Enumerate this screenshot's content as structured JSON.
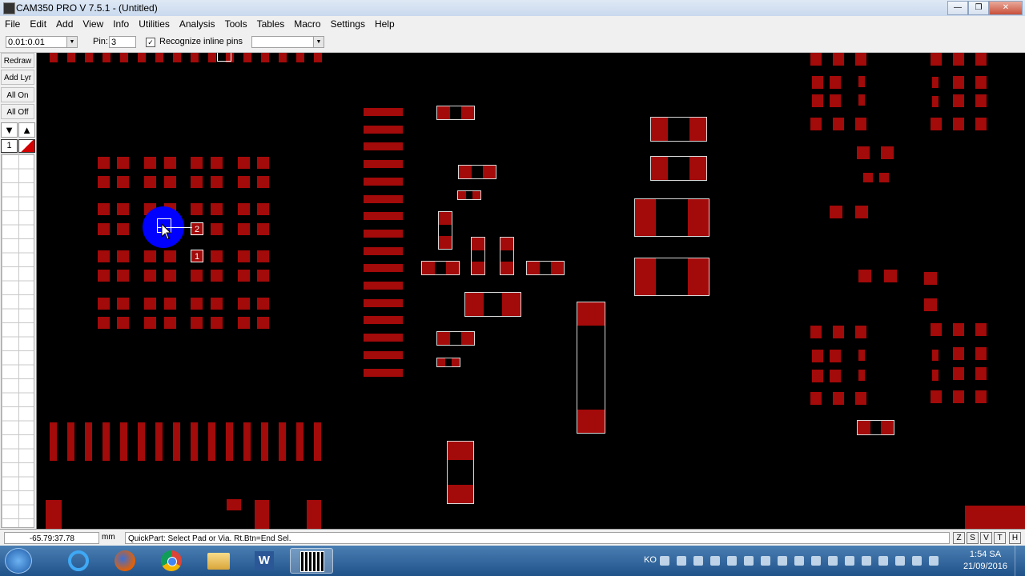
{
  "window": {
    "title": "CAM350 PRO V 7.5.1 - (Untitled)"
  },
  "menu": [
    "File",
    "Edit",
    "Add",
    "View",
    "Info",
    "Utilities",
    "Analysis",
    "Tools",
    "Tables",
    "Macro",
    "Settings",
    "Help"
  ],
  "toolbar": {
    "grid_value": "0.01:0.01",
    "pin_label": "Pin:",
    "pin_value": "3",
    "recognize_label": "Recognize inline pins",
    "recognize_checked": true,
    "layer_combo_value": ""
  },
  "left_panel": {
    "buttons": [
      "Redraw",
      "Add Lyr",
      "All On",
      "All Off"
    ],
    "layer_number": "1"
  },
  "canvas": {
    "pin_labels": [
      "2",
      "1"
    ],
    "pad_color": "#a30a0a",
    "selection_color": "#0000ff"
  },
  "status": {
    "coords": "-65.79:37.78",
    "unit": "mm",
    "message": "QuickPart: Select Pad or Via. Rt.Btn=End Sel.",
    "mode_buttons": [
      "Z",
      "S",
      "V",
      "T",
      "H"
    ]
  },
  "taskbar": {
    "tray_lang": "KO",
    "time": "1:54 SA",
    "date": "21/09/2016"
  }
}
